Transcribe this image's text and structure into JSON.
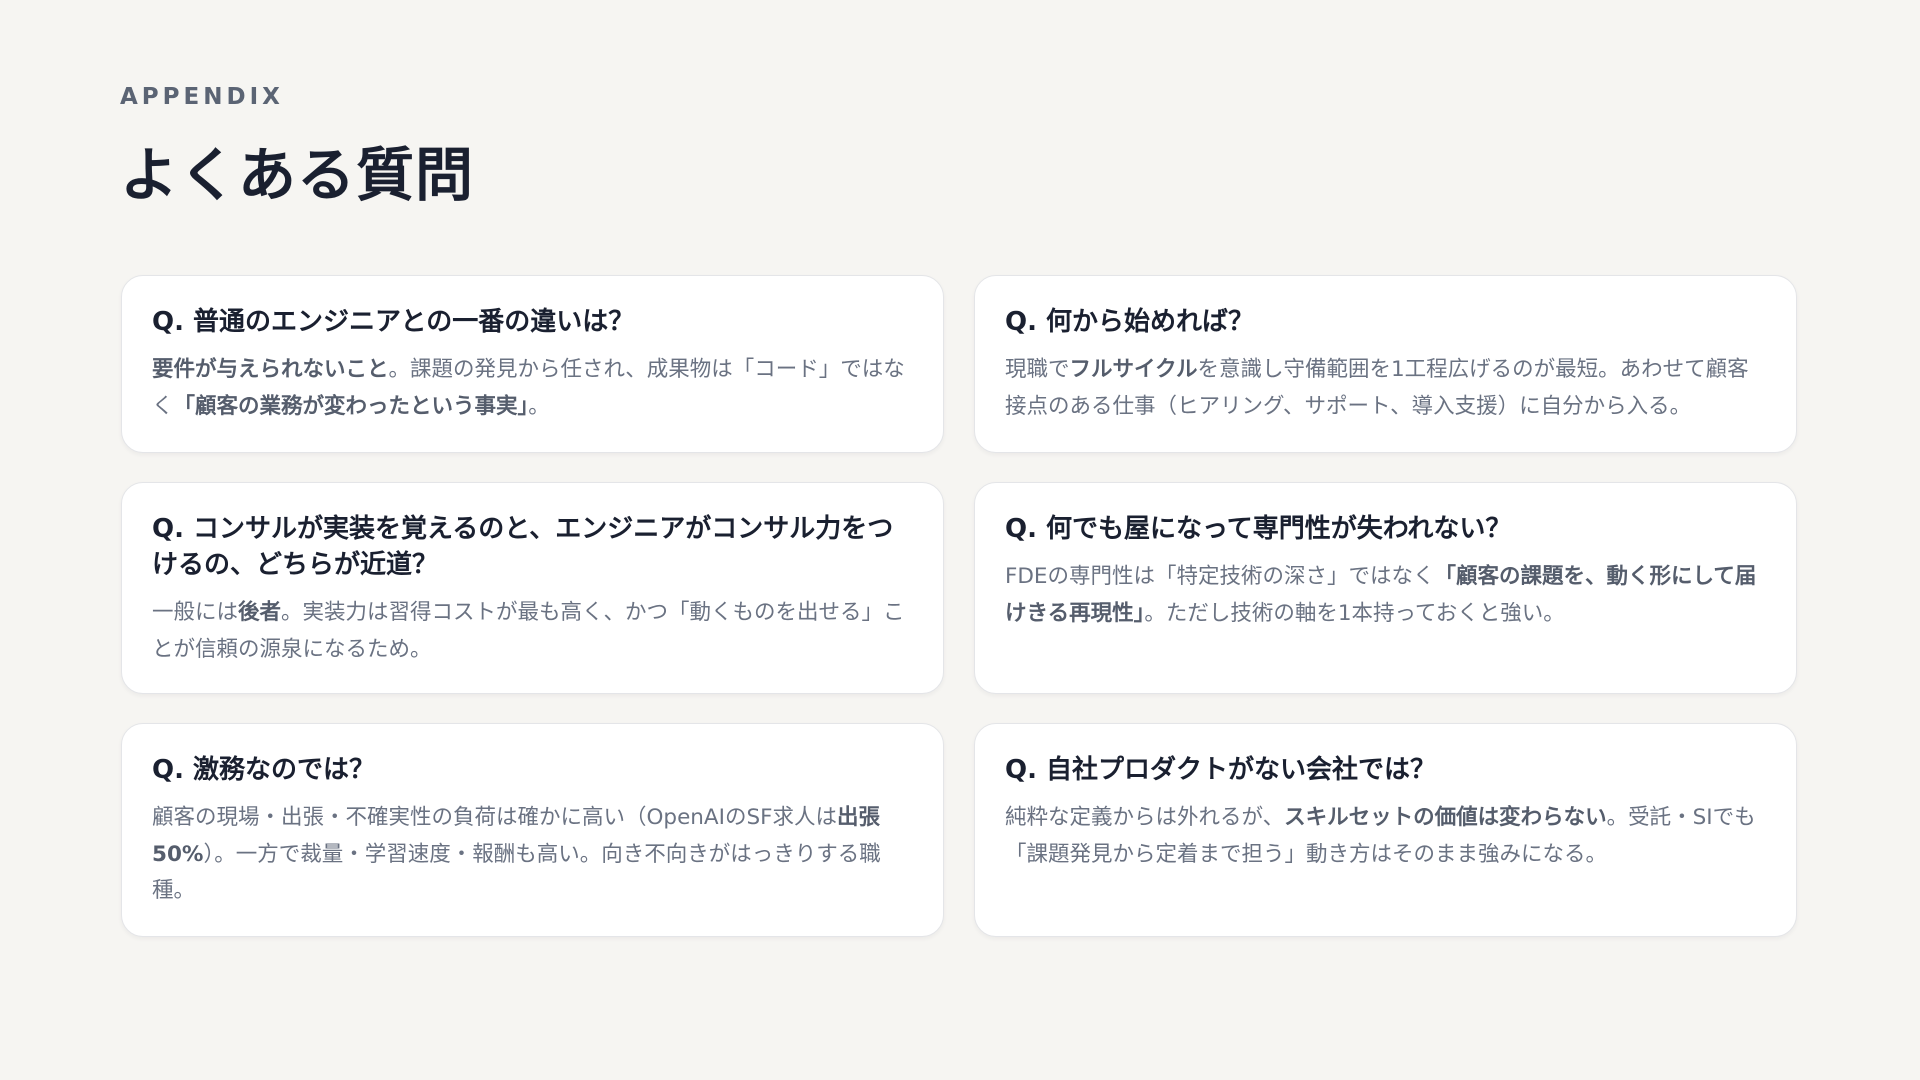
{
  "header": {
    "eyebrow": "APPENDIX",
    "title": "よくある質問"
  },
  "faq": [
    {
      "question": "Q. 普通のエンジニアとの一番の違いは？",
      "answer": [
        {
          "text": "要件が与えられないこと",
          "bold": true
        },
        {
          "text": "。課題の発見から任され、成果物は「コード」ではなく",
          "bold": false
        },
        {
          "text": "「顧客の業務が変わったという事実」",
          "bold": true
        },
        {
          "text": "。",
          "bold": false
        }
      ]
    },
    {
      "question": "Q. 何から始めれば？",
      "answer": [
        {
          "text": "現職で",
          "bold": false
        },
        {
          "text": "フルサイクル",
          "bold": true
        },
        {
          "text": "を意識し守備範囲を1工程広げるのが最短。あわせて顧客接点のある仕事（ヒアリング、サポート、導入支援）に自分から入る。",
          "bold": false
        }
      ]
    },
    {
      "question": "Q. コンサルが実装を覚えるのと、エンジニアがコンサル力をつけるの、どちらが近道？",
      "answer": [
        {
          "text": "一般には",
          "bold": false
        },
        {
          "text": "後者",
          "bold": true
        },
        {
          "text": "。実装力は習得コストが最も高く、かつ「動くものを出せる」ことが信頼の源泉になるため。",
          "bold": false
        }
      ]
    },
    {
      "question": "Q. 何でも屋になって専門性が失われない？",
      "answer": [
        {
          "text": "FDEの専門性は「特定技術の深さ」ではなく",
          "bold": false
        },
        {
          "text": "「顧客の課題を、動く形にして届けきる再現性」",
          "bold": true
        },
        {
          "text": "。ただし技術の軸を1本持っておくと強い。",
          "bold": false
        }
      ]
    },
    {
      "question": "Q. 激務なのでは？",
      "answer": [
        {
          "text": "顧客の現場・出張・不確実性の負荷は確かに高い（OpenAIのSF求人は",
          "bold": false
        },
        {
          "text": "出張50%",
          "bold": true
        },
        {
          "text": "）。一方で裁量・学習速度・報酬も高い。向き不向きがはっきりする職種。",
          "bold": false
        }
      ]
    },
    {
      "question": "Q. 自社プロダクトがない会社では？",
      "answer": [
        {
          "text": "純粋な定義からは外れるが、",
          "bold": false
        },
        {
          "text": "スキルセットの価値は変わらない",
          "bold": true
        },
        {
          "text": "。受託・SIでも「課題発見から定着まで担う」動き方はそのまま強みになる。",
          "bold": false
        }
      ]
    }
  ]
}
